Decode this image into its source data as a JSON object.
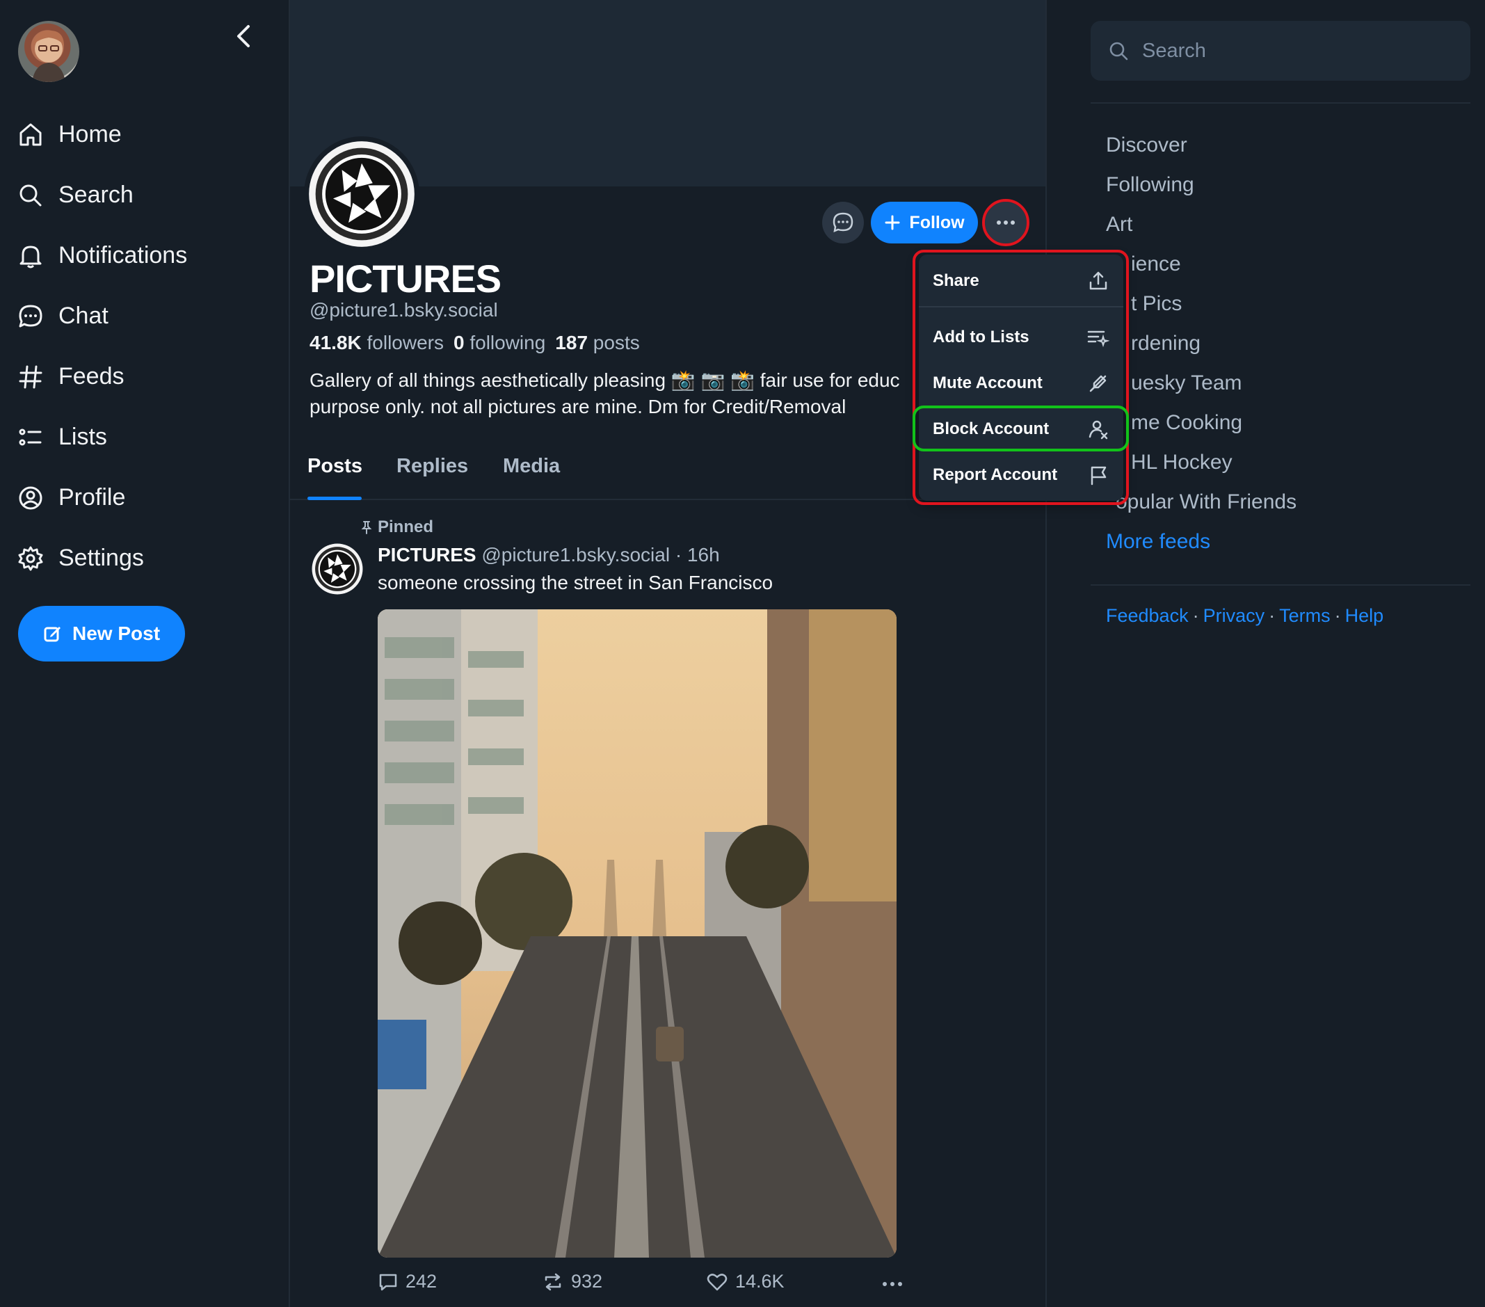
{
  "left_nav": {
    "items": [
      {
        "label": "Home",
        "icon": "home-icon"
      },
      {
        "label": "Search",
        "icon": "search-icon"
      },
      {
        "label": "Notifications",
        "icon": "bell-icon"
      },
      {
        "label": "Chat",
        "icon": "chat-icon"
      },
      {
        "label": "Feeds",
        "icon": "hash-icon"
      },
      {
        "label": "Lists",
        "icon": "list-icon"
      },
      {
        "label": "Profile",
        "icon": "user-circle-icon"
      },
      {
        "label": "Settings",
        "icon": "gear-icon"
      }
    ],
    "new_post_label": "New Post"
  },
  "profile": {
    "display_name": "PICTURES",
    "handle": "@picture1.bsky.social",
    "followers_count": "41.8K",
    "followers_label": "followers",
    "following_count": "0",
    "following_label": "following",
    "posts_count": "187",
    "posts_label": "posts",
    "bio_line1": "Gallery of all things aesthetically pleasing 📸 📷 📸 fair use for educ",
    "bio_line2": "purpose only. not all pictures are mine. Dm for Credit/Removal",
    "follow_label": "Follow"
  },
  "tabs": [
    {
      "label": "Posts",
      "active": true
    },
    {
      "label": "Replies",
      "active": false
    },
    {
      "label": "Media",
      "active": false
    }
  ],
  "post": {
    "pinned_label": "Pinned",
    "author": "PICTURES",
    "handle": "@picture1.bsky.social",
    "time": "16h",
    "text": "someone crossing the street in San Francisco",
    "replies": "242",
    "reposts": "932",
    "likes": "14.6K"
  },
  "menu": {
    "items": [
      {
        "label": "Share",
        "icon": "share-icon"
      },
      {
        "label": "Add to Lists",
        "icon": "add-list-icon"
      },
      {
        "label": "Mute Account",
        "icon": "mute-icon"
      },
      {
        "label": "Block Account",
        "icon": "block-user-icon"
      },
      {
        "label": "Report Account",
        "icon": "flag-icon"
      }
    ]
  },
  "right": {
    "search_placeholder": "Search",
    "feeds": [
      "Discover",
      "Following",
      "Art",
      "ience",
      "t Pics",
      "rdening",
      "uesky Team",
      "me Cooking",
      "HL Hockey",
      "opular With Friends"
    ],
    "more_feeds": "More feeds",
    "footer": [
      "Feedback",
      "Privacy",
      "Terms",
      "Help"
    ]
  },
  "colors": {
    "background": "#161e27",
    "accent": "#1083fe",
    "highlight_red": "#e0141e",
    "highlight_green": "#12c21a"
  }
}
